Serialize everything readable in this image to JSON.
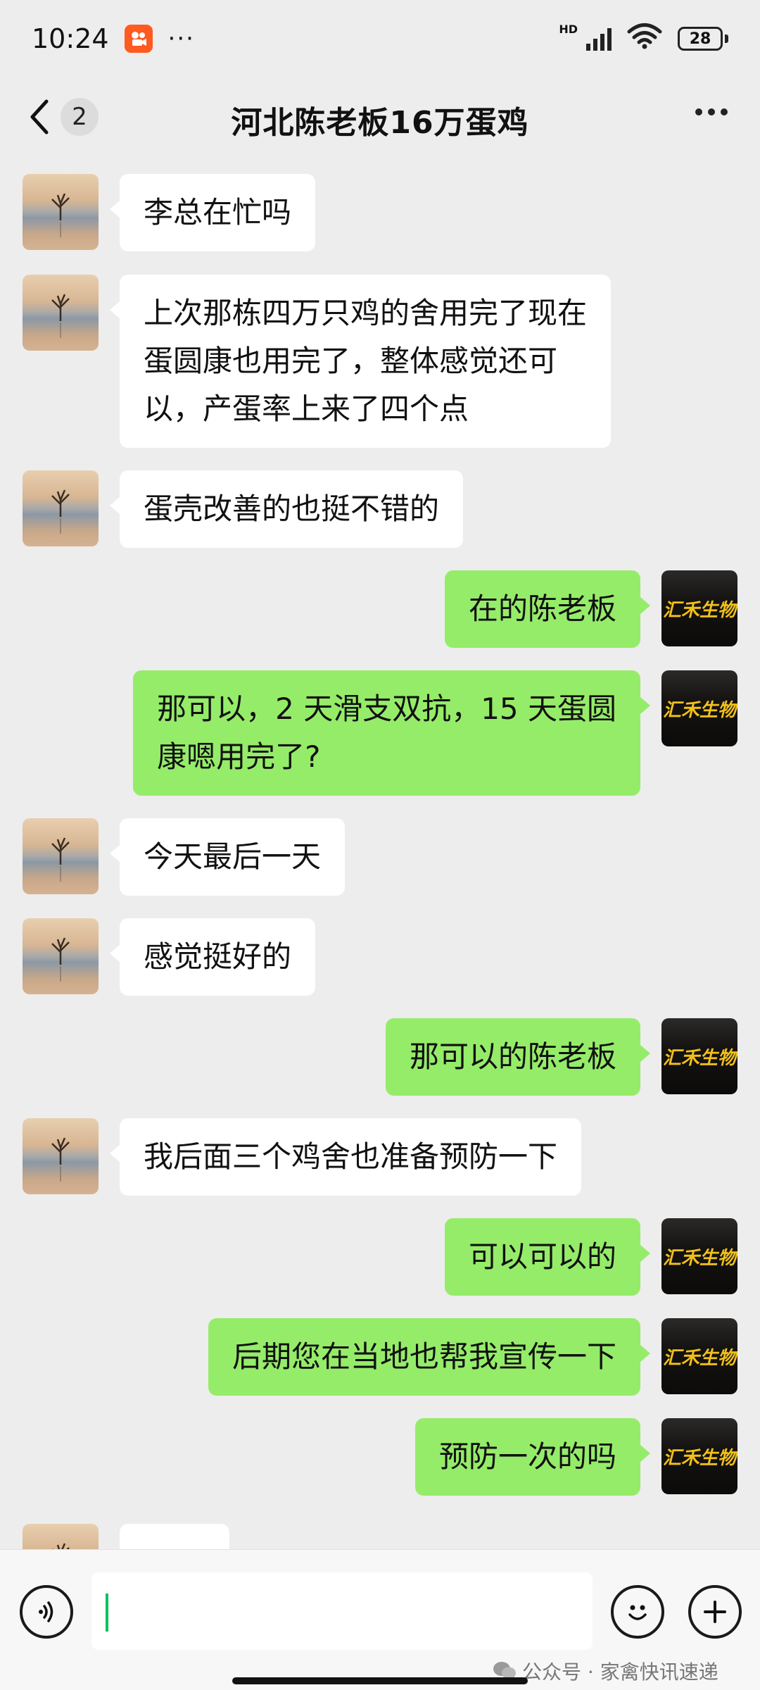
{
  "status_bar": {
    "time": "10:24",
    "battery": "28",
    "network": "HD",
    "more": "···"
  },
  "nav": {
    "unread_count": "2",
    "title": "河北陈老板16万蛋鸡"
  },
  "messages": [
    {
      "side": "left",
      "text": "李总在忙吗",
      "avatar": "lake-tree-avatar"
    },
    {
      "side": "left",
      "lines": [
        "上次那栋四万只鸡的舍用完了现在",
        "蛋圆康也用完了，整体感觉还可",
        "以，产蛋率上来了四个点"
      ],
      "avatar": "lake-tree-avatar"
    },
    {
      "side": "left",
      "text": "蛋壳改善的也挺不错的",
      "avatar": "lake-tree-avatar"
    },
    {
      "side": "right",
      "text": "在的陈老板",
      "avatar": "brand-avatar"
    },
    {
      "side": "right",
      "lines": [
        "那可以，2 天滑支双抗，15 天蛋圆",
        "康嗯用完了?"
      ],
      "avatar": "brand-avatar"
    },
    {
      "side": "left",
      "text": "今天最后一天",
      "avatar": "lake-tree-avatar"
    },
    {
      "side": "left",
      "text": "感觉挺好的",
      "avatar": "lake-tree-avatar"
    },
    {
      "side": "right",
      "text": "那可以的陈老板",
      "avatar": "brand-avatar"
    },
    {
      "side": "left",
      "text": "我后面三个鸡舍也准备预防一下",
      "avatar": "lake-tree-avatar"
    },
    {
      "side": "right",
      "text": "可以可以的",
      "avatar": "brand-avatar"
    },
    {
      "side": "right",
      "text": "后期您在当地也帮我宣传一下",
      "avatar": "brand-avatar"
    },
    {
      "side": "right",
      "text": "预防一次的吗",
      "avatar": "brand-avatar"
    }
  ],
  "brand_avatar_text": "汇禾生物",
  "watermark": {
    "text": "公众号 · 家禽快讯速递"
  },
  "colors": {
    "background": "#ededed",
    "incoming_bubble": "#ffffff",
    "outgoing_bubble": "#95ec69",
    "cursor": "#07c160",
    "app_badge": "#ff5a1f"
  }
}
